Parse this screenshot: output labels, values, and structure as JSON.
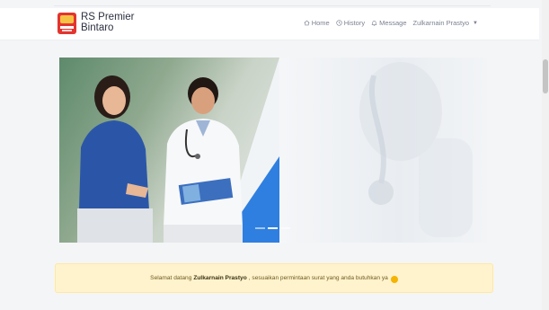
{
  "header": {
    "brand_line1": "RS Premier",
    "brand_line2": "Bintaro",
    "nav": {
      "home": "Home",
      "history": "History",
      "message": "Message",
      "user": "Zulkarnain Prastyo"
    }
  },
  "hero": {
    "slides": 3,
    "active_slide": 2
  },
  "welcome": {
    "prefix": "Selamat datang",
    "name": "Zulkarnain Prastyo",
    "suffix": ", sesuaikan permintaan surat yang anda butuhkan ya"
  },
  "colors": {
    "brand_red": "#e3342f",
    "alert_bg": "#fff3cd",
    "hero_blue": "#2f7fe0"
  }
}
